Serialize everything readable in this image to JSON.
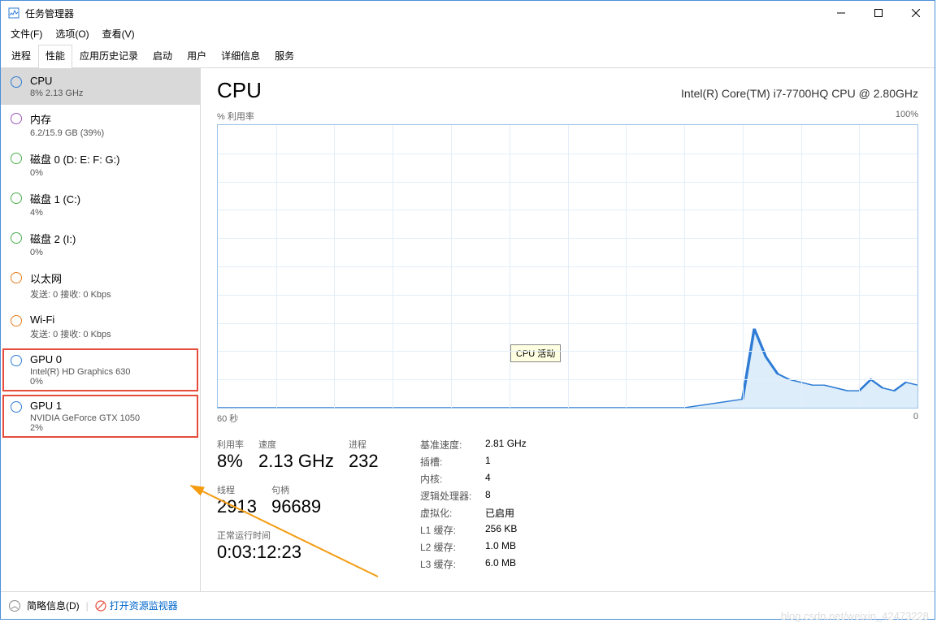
{
  "window": {
    "title": "任务管理器"
  },
  "menubar": [
    "文件(F)",
    "选项(O)",
    "查看(V)"
  ],
  "tabs": [
    "进程",
    "性能",
    "应用历史记录",
    "启动",
    "用户",
    "详细信息",
    "服务"
  ],
  "active_tab": 1,
  "sidebar": [
    {
      "ring": "blue",
      "name": "CPU",
      "sub": "8% 2.13 GHz",
      "selected": true
    },
    {
      "ring": "purple",
      "name": "内存",
      "sub": "6.2/15.9 GB (39%)"
    },
    {
      "ring": "green",
      "name": "磁盘 0 (D: E: F: G:)",
      "sub": "0%"
    },
    {
      "ring": "green",
      "name": "磁盘 1 (C:)",
      "sub": "4%"
    },
    {
      "ring": "green",
      "name": "磁盘 2 (I:)",
      "sub": "0%"
    },
    {
      "ring": "orange",
      "name": "以太网",
      "sub": "发送: 0 接收: 0 Kbps"
    },
    {
      "ring": "orange",
      "name": "Wi-Fi",
      "sub": "发送: 0 接收: 0 Kbps"
    },
    {
      "ring": "blue",
      "name": "GPU 0",
      "sub": "Intel(R) HD Graphics 630\n0%",
      "boxed": true
    },
    {
      "ring": "blue",
      "name": "GPU 1",
      "sub": "NVIDIA GeForce GTX 1050\n2%",
      "boxed": true
    }
  ],
  "main": {
    "title": "CPU",
    "subtitle": "Intel(R) Core(TM) i7-7700HQ CPU @ 2.80GHz",
    "chart_top_left": "% 利用率",
    "chart_top_right": "100%",
    "chart_bottom_left": "60 秒",
    "chart_bottom_right": "0",
    "tooltip": "CPU 活动",
    "stats_left": [
      {
        "lbl": "利用率",
        "val": "8%"
      },
      {
        "lbl": "速度",
        "val": "2.13 GHz"
      },
      {
        "lbl": "进程",
        "val": "232"
      },
      {
        "lbl": "线程",
        "val": "2913"
      },
      {
        "lbl": "句柄",
        "val": "96689"
      },
      {
        "lbl": "正常运行时间",
        "val": "0:03:12:23",
        "wide": true
      }
    ],
    "stats_right": [
      {
        "k": "基准速度:",
        "v": "2.81 GHz"
      },
      {
        "k": "插槽:",
        "v": "1"
      },
      {
        "k": "内核:",
        "v": "4"
      },
      {
        "k": "逻辑处理器:",
        "v": "8"
      },
      {
        "k": "虚拟化:",
        "v": "已启用"
      },
      {
        "k": "L1 缓存:",
        "v": "256 KB"
      },
      {
        "k": "L2 缓存:",
        "v": "1.0 MB"
      },
      {
        "k": "L3 缓存:",
        "v": "6.0 MB"
      }
    ]
  },
  "footer": {
    "brief": "简略信息(D)",
    "monitor": "打开资源监视器"
  },
  "watermark": "blog.csdn.net/weixin_42473228",
  "chart_data": {
    "type": "line",
    "title": "CPU 活动",
    "xlabel": "60 秒 → 0",
    "ylabel": "% 利用率",
    "ylim": [
      0,
      100
    ],
    "x_seconds_ago": [
      60,
      55,
      50,
      45,
      40,
      35,
      30,
      25,
      20,
      15,
      14,
      13,
      12,
      11,
      10,
      9,
      8,
      7,
      6,
      5,
      4,
      3,
      2,
      1,
      0
    ],
    "utilization_pct": [
      0,
      0,
      0,
      0,
      0,
      0,
      0,
      0,
      0,
      3,
      28,
      18,
      12,
      10,
      9,
      8,
      8,
      7,
      6,
      6,
      10,
      7,
      6,
      9,
      8
    ]
  }
}
